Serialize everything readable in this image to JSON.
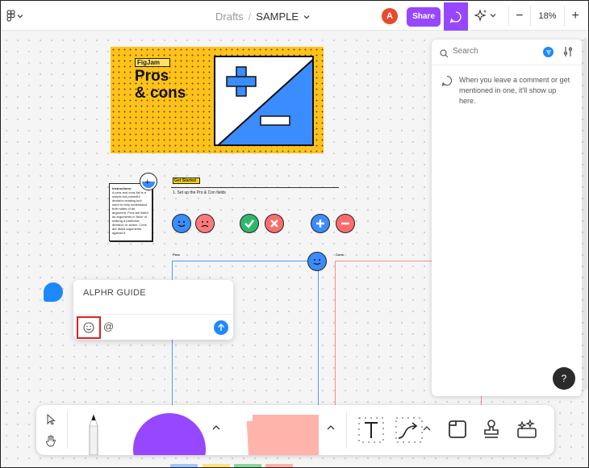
{
  "topbar": {
    "breadcrumb_drafts": "Drafts",
    "breadcrumb_sep": "/",
    "file_name": "SAMPLE",
    "avatar_initial": "A",
    "share_label": "Share",
    "zoom_out": "−",
    "zoom_level": "18%",
    "zoom_in": "+"
  },
  "template": {
    "tag": "FigJam",
    "title_line1": "Pros",
    "title_line2": "& cons",
    "instructions_heading": "Instructions:",
    "instructions_body": "A pros and cons list is a simple but powerful decision-making tool used to help understand both sides of an argument. Pros are listed as arguments in favor of making a particular decision or action. Cons are listed arguments against it.",
    "get_started_tag": "Get Started",
    "get_started_step": "1. Set up the Pro & Con fields",
    "pros_label": "Pros",
    "cons_label": "Cons"
  },
  "composer": {
    "text": "ALPHR GUIDE",
    "mention_symbol": "@"
  },
  "panel": {
    "search_placeholder": "Search",
    "empty_message": "When you leave a comment or get mentioned in one, it'll show up here."
  },
  "help": {
    "label": "?"
  },
  "colors": {
    "accent": "#9747ff",
    "blue": "#1e88ff",
    "template_yellow": "#ffc21a",
    "sticky_pink": "#ffa8a0",
    "shape_purple": "#9747ff",
    "highlight_red": "#e02020"
  },
  "icons": [
    "figma-menu-icon",
    "chevron-down-icon",
    "comment-icon",
    "ai-sparkle-icon",
    "search-icon",
    "filter-icon",
    "settings-sliders-icon",
    "emoji-icon",
    "send-arrow-icon",
    "cursor-arrow-icon",
    "hand-icon",
    "pen-icon",
    "text-icon",
    "connector-icon",
    "section-icon",
    "stamp-icon",
    "widgets-icon"
  ]
}
